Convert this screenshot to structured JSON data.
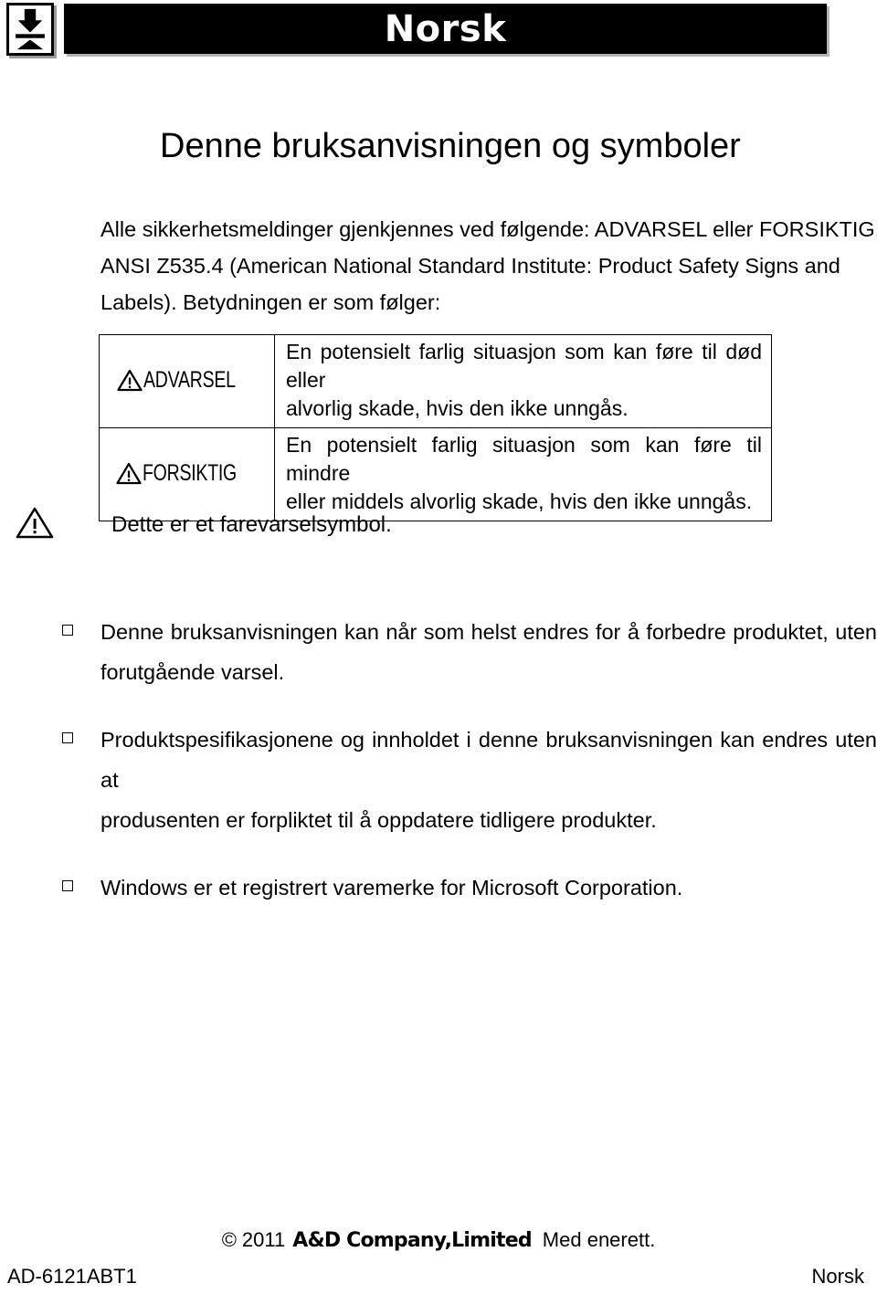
{
  "header": {
    "title": "Norsk",
    "logo_icon": "ad-compression-arrow-icon"
  },
  "heading": "Denne bruksanvisningen og symboler",
  "intro": {
    "line1": "Alle sikkerhetsmeldinger gjenkjennes ved følgende: ADVARSEL eller FORSIKTIG, av",
    "line2": "ANSI Z535.4 (American National Standard Institute: Product Safety Signs and",
    "line3": "Labels). Betydningen er som følger:"
  },
  "warning_table": {
    "rows": [
      {
        "label": "ADVARSEL",
        "icon": "warning-triangle-icon",
        "desc_line1": "En potensielt farlig situasjon som kan føre til død eller",
        "desc_line2": "alvorlig skade, hvis den ikke unngås."
      },
      {
        "label": "FORSIKTIG",
        "icon": "warning-triangle-icon",
        "desc_line1": "En potensielt farlig situasjon som kan føre til mindre",
        "desc_line2": "eller middels alvorlig skade, hvis den ikke unngås."
      }
    ]
  },
  "hazard_note": {
    "icon": "warning-triangle-icon",
    "text": "Dette er et farevarselsymbol."
  },
  "bullets": [
    {
      "marker": "hollow-square-bullet",
      "line1": "Denne bruksanvisningen kan når som helst endres for å forbedre produktet, uten",
      "line2": "forutgående varsel."
    },
    {
      "marker": "hollow-square-bullet",
      "line1": "Produktspesifikasjonene og innholdet i denne bruksanvisningen kan endres uten at",
      "line2": "produsenten er forpliktet til å oppdatere tidligere produkter."
    },
    {
      "marker": "hollow-square-bullet",
      "line1": "Windows er et registrert varemerke for Microsoft Corporation.",
      "line2": ""
    }
  ],
  "footer": {
    "copyright_symbol": "©",
    "year": "2011",
    "company": "A&D Company,Limited",
    "rights": "Med enerett.",
    "doc_code": "AD-6121ABT1",
    "language": "Norsk"
  },
  "colors": {
    "banner_bg": "#000000",
    "banner_text": "#ffffff",
    "page_bg": "#ffffff",
    "body_text": "#000000",
    "shadow": "#b5b5b5"
  }
}
